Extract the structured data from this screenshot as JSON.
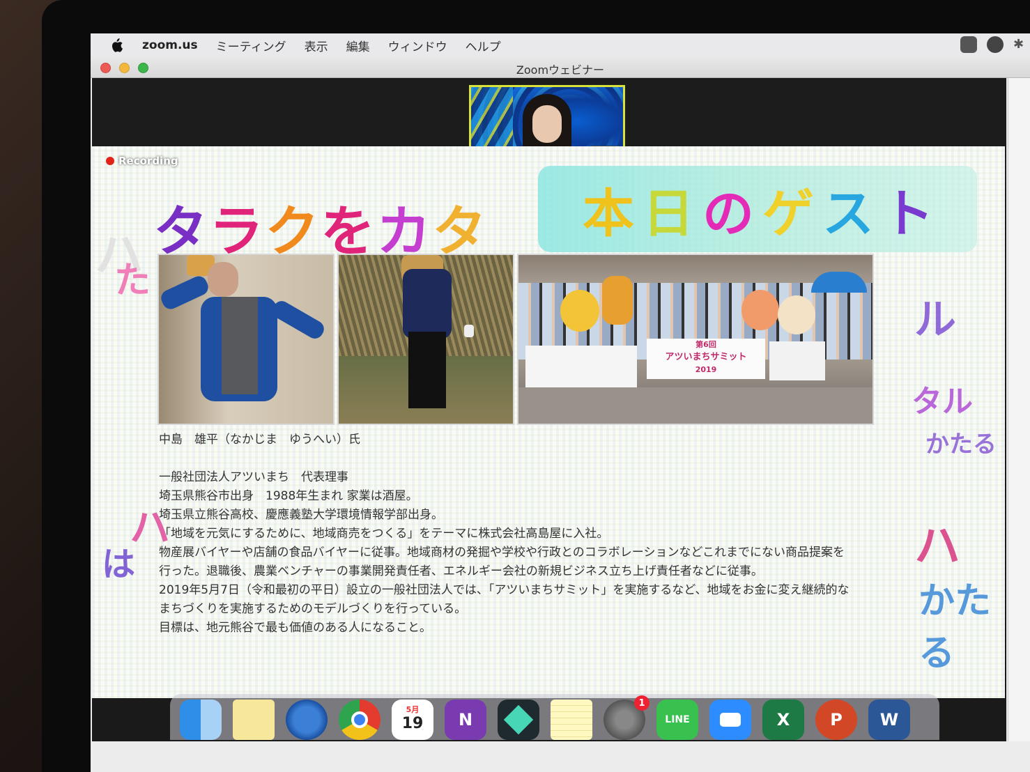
{
  "menubar": {
    "app_name": "zoom.us",
    "items": [
      "ミーティング",
      "表示",
      "編集",
      "ウィンドウ",
      "ヘルプ"
    ]
  },
  "window": {
    "title": "Zoomウェビナー"
  },
  "slide": {
    "recording_label": "Recording",
    "title_chars": [
      "タ",
      "ラ",
      "ク",
      "を",
      "カ",
      "タ"
    ],
    "guest_banner_chars": [
      "本",
      "日",
      "の",
      "ゲ",
      "ス",
      "ト"
    ],
    "photo3_banner": {
      "line1": "第6回",
      "line2": "アツいまちサミット",
      "line3": "2019"
    },
    "bio": {
      "name": "中島　雄平（なかじま　ゆうへい）氏",
      "lines": [
        "一般社団法人アツいまち　代表理事",
        "埼玉県熊谷市出身　1988年生まれ 家業は酒屋。",
        "埼玉県立熊谷高校、慶應義塾大学環境情報学部出身。",
        "「地域を元気にするために、地域商売をつくる」をテーマに株式会社高島屋に入社。",
        "物産展バイヤーや店舗の食品バイヤーに従事。地域商材の発掘や学校や行政とのコラボレーションなどこれまでにない商品提案を",
        "行った。退職後、農業ベンチャーの事業開発責任者、エネルギー会社の新規ビジネス立ち上げ責任者などに従事。",
        "2019年5月7日（令和最初の平日）設立の一般社団法人では、「アツいまちサミット」を実施するなど、地域をお金に変え継続的な",
        "まちづくりを実施するためのモデルづくりを行っている。",
        "目標は、地元熊谷で最も価値のある人になること。"
      ]
    },
    "deco_text": [
      "ハ",
      "た",
      "は",
      "ル",
      "タル",
      "かたる",
      "かたる",
      "は",
      "た"
    ]
  },
  "dock": {
    "calendar_month": "5月",
    "calendar_day": "19",
    "settings_badge": "1",
    "apps": [
      {
        "name": "finder",
        "label": ""
      },
      {
        "name": "stickies",
        "label": ""
      },
      {
        "name": "thunderbird",
        "label": ""
      },
      {
        "name": "chrome",
        "label": ""
      },
      {
        "name": "calendar",
        "label": ""
      },
      {
        "name": "onenote",
        "label": "N"
      },
      {
        "name": "filmora",
        "label": ""
      },
      {
        "name": "notes",
        "label": ""
      },
      {
        "name": "system-preferences",
        "label": ""
      },
      {
        "name": "line",
        "label": "LINE"
      },
      {
        "name": "zoom",
        "label": ""
      },
      {
        "name": "excel",
        "label": "X"
      },
      {
        "name": "powerpoint",
        "label": "P"
      },
      {
        "name": "word",
        "label": "W"
      }
    ]
  },
  "colors": {
    "title_colors": [
      "#7a2fc4",
      "#e0247a",
      "#f08a1c",
      "#e0247a",
      "#c43fd0",
      "#f0b030"
    ],
    "banner_colors": [
      "#f0c21c",
      "#c6d83a",
      "#e32bb8",
      "#f0d02a",
      "#27a6e0",
      "#7a3ad0"
    ],
    "speaker_border": "#d9e23b",
    "recording_dot": "#e2231a"
  }
}
